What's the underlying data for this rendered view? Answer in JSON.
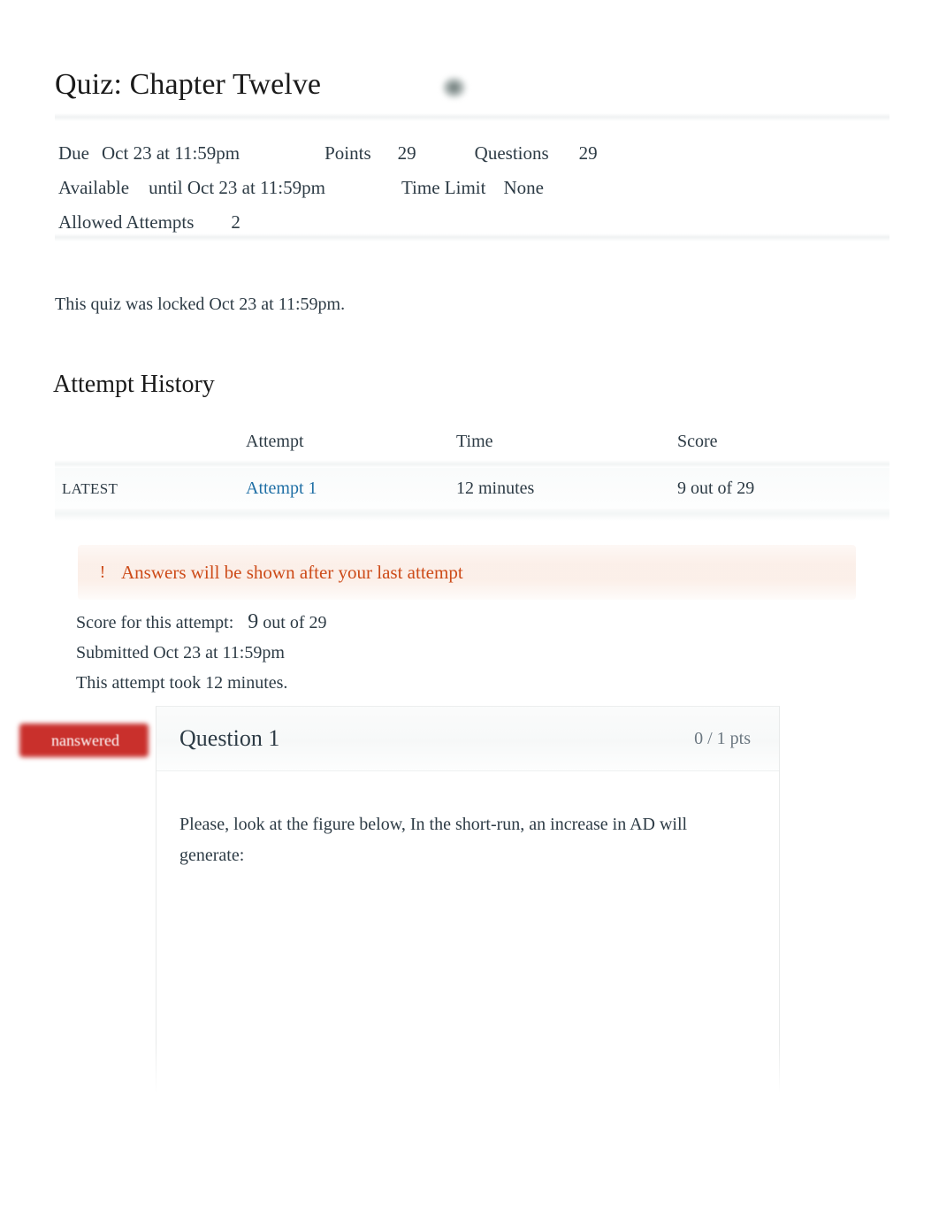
{
  "header": {
    "title": "Quiz: Chapter Twelve",
    "icon": "redacted-icon"
  },
  "meta": {
    "due_label": "Due",
    "due_value": "Oct 23 at 11:59pm",
    "points_label": "Points",
    "points_value": "29",
    "questions_label": "Questions",
    "questions_value": "29",
    "available_label": "Available",
    "available_value": "until Oct 23 at 11:59pm",
    "time_limit_label": "Time Limit",
    "time_limit_value": "None",
    "allowed_attempts_label": "Allowed Attempts",
    "allowed_attempts_value": "2"
  },
  "locked_notice": "This quiz was locked Oct 23 at 11:59pm.",
  "attempt_history": {
    "heading": "Attempt History",
    "columns": [
      "",
      "Attempt",
      "Time",
      "Score"
    ],
    "rows": [
      {
        "kept": "LATEST",
        "attempt": "Attempt 1",
        "time": "12 minutes",
        "score": "9 out of 29"
      }
    ]
  },
  "warning": {
    "icon": "exclamation-icon",
    "text": "Answers will be shown after your last attempt",
    "color": "#cd4b19",
    "background": "#fbeee7"
  },
  "attempt_summary": {
    "score_label": "Score for this attempt:",
    "score_value": "9",
    "score_out_of": "out of 29",
    "submitted": "Submitted Oct 23 at 11:59pm",
    "duration": "This attempt took 12 minutes."
  },
  "question": {
    "status_badge": "nanswered",
    "status_color": "#c9302c",
    "name": "Question 1",
    "points": "0 / 1 pts",
    "text": "Please, look at the figure below, In the short-run, an increase in AD will generate:"
  }
}
